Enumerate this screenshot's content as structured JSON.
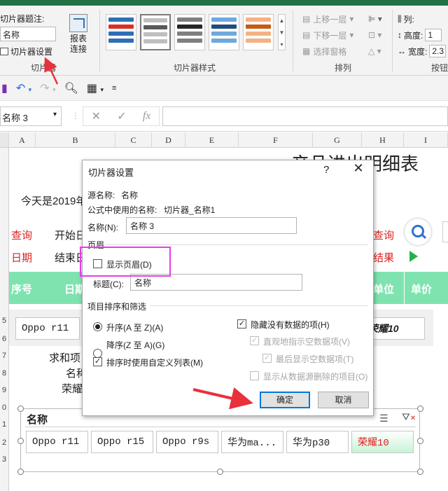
{
  "ribbon": {
    "caption_label": "切片器题注:",
    "caption_value": "名称",
    "slicer_settings": "切片器设置",
    "report_label_1": "报表",
    "report_label_2": "连接",
    "group_slicer": "切片器",
    "group_styles": "切片器样式",
    "group_arrange": "排列",
    "bring_forward": "上移一层",
    "send_backward": "下移一层",
    "selection_pane": "选择窗格",
    "columns_label": "列:",
    "height_label": "高度:",
    "height_value": "1",
    "width_label": "宽度:",
    "width_value": "2.3",
    "group_buttons": "按钮"
  },
  "formula_bar": {
    "name_box": "名称 3",
    "cancel": "✕",
    "enter": "✓",
    "fx": "fx"
  },
  "columns": [
    "A",
    "B",
    "C",
    "D",
    "E",
    "F",
    "G",
    "H",
    "I"
  ],
  "row_numbers": [
    "5",
    "6",
    "7",
    "8",
    "9",
    "0",
    "1",
    "2",
    "3"
  ],
  "sheet": {
    "title": "产品进出明细表",
    "today": "今天是2019年",
    "query_left": "查询",
    "start_date": "开始日",
    "date_left": "日期",
    "end_date": "结束日",
    "query_right": "查询",
    "result_right": "结果",
    "hdr_seq": "序号",
    "hdr_date": "日期",
    "hdr_unit": "单位",
    "hdr_price": "单价",
    "b1": "求和项",
    "b2": "名称",
    "b3": "荣耀1"
  },
  "slicer_top": {
    "first": "Oppo r11",
    "last": "荣耀10"
  },
  "slicer_bottom": {
    "title": "名称",
    "items": [
      {
        "label": "Oppo r11"
      },
      {
        "label": "Oppo r15"
      },
      {
        "label": "Oppo r9s"
      },
      {
        "label": "华为ma..."
      },
      {
        "label": "华为p30"
      },
      {
        "label": "荣耀10"
      }
    ]
  },
  "dialog": {
    "title": "切片器设置",
    "help": "?",
    "close": "✕",
    "source_name_label": "源名称:",
    "source_name_value": "名称",
    "formula_name_label": "公式中使用的名称:",
    "formula_name_value": "切片器_名称1",
    "name_label": "名称(N):",
    "name_value": "名称 3",
    "header_section": "页眉",
    "show_header": "显示页眉(D)",
    "caption_label": "标题(C):",
    "caption_value": "名称",
    "sort_section": "项目排序和筛选",
    "asc": "升序(A 至 Z)(A)",
    "desc": "降序(Z 至 A)(G)",
    "custom_list": "排序时使用自定义列表(M)",
    "hide_no_data": "隐藏没有数据的项(H)",
    "visually_indicate": "直观地指示空数据项(V)",
    "show_last": "最后显示空数据项(T)",
    "show_deleted": "显示从数据源删除的项目(O)",
    "ok": "确定",
    "cancel": "取消"
  },
  "colors": {
    "ribbon_green": "#217346",
    "header_band": "#7fe3b0",
    "arrow_red": "#e8313b",
    "highlight_magenta": "#e63de6",
    "accent_blue": "#0078d7"
  }
}
